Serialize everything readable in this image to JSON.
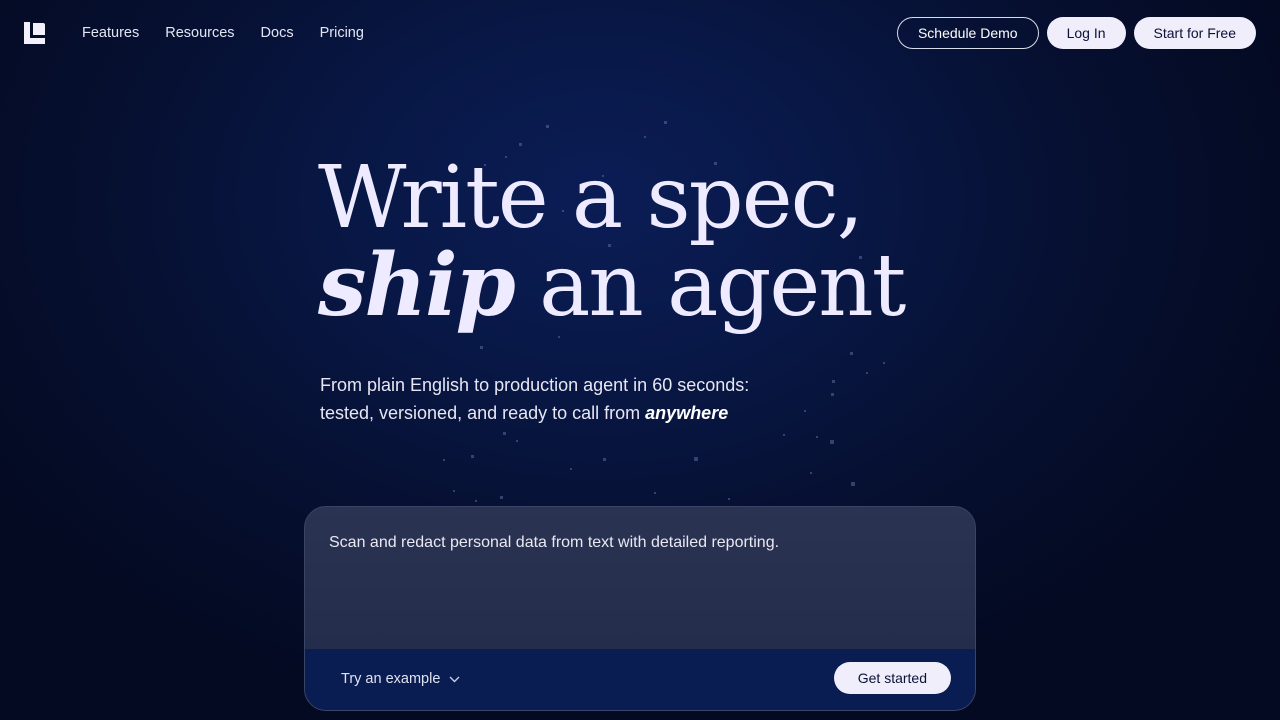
{
  "nav": {
    "logo_icon": "brand-logo-icon",
    "links": [
      "Features",
      "Resources",
      "Docs",
      "Pricing"
    ],
    "schedule_demo": "Schedule Demo",
    "log_in": "Log In",
    "start_free": "Start for Free"
  },
  "hero": {
    "line1": "Write a spec,",
    "line2_emph": "ship",
    "line2_rest": " an agent",
    "sub_line1": "From plain English to production agent in 60 seconds:",
    "sub_line2": "tested, versioned, and ready to call from ",
    "sub_emph": "anywhere"
  },
  "prompt_card": {
    "text": "Scan and redact personal data from text with detailed reporting.",
    "try_example": "Try an example",
    "try_icon": "chevron-down-icon",
    "get_started": "Get started"
  },
  "colors": {
    "background": "#061032",
    "headline": "#eeeaff",
    "button_light": "#f1eefb",
    "card_footer": "#0a1d52"
  }
}
